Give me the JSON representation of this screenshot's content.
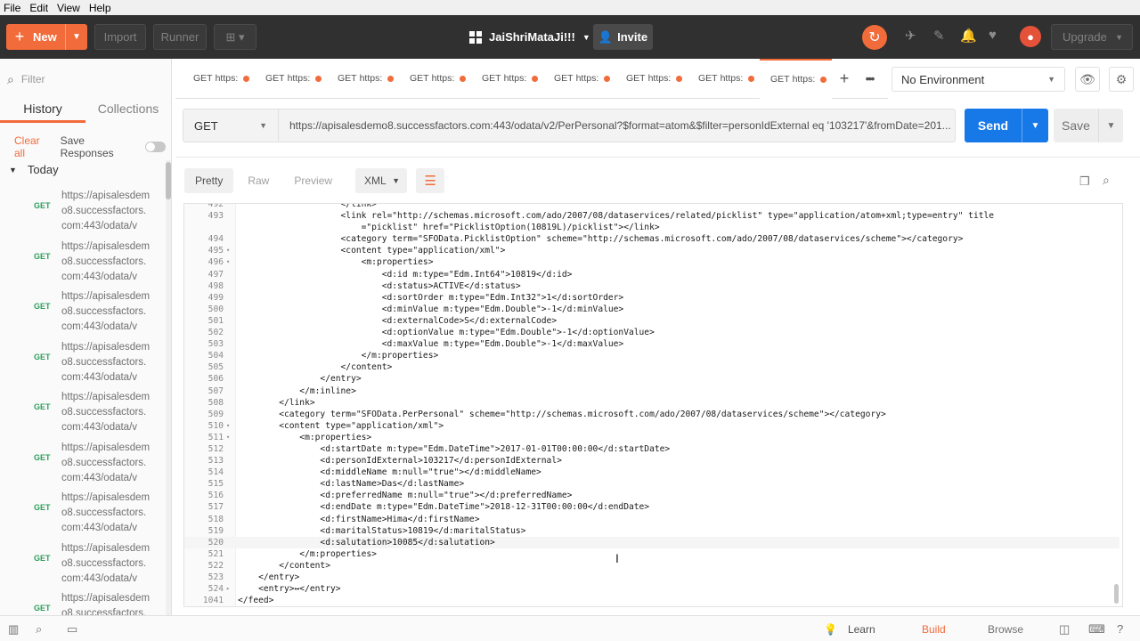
{
  "menu": [
    "File",
    "Edit",
    "View",
    "Help"
  ],
  "topbar": {
    "new_label": "New",
    "import_label": "Import",
    "runner_label": "Runner",
    "workspace": "JaiShriMataJi!!!",
    "invite_label": "Invite",
    "upgrade_label": "Upgrade",
    "accent": "#f26b3a"
  },
  "sidebar": {
    "filter_placeholder": "Filter",
    "tabs": [
      "History",
      "Collections"
    ],
    "clear_all": "Clear all",
    "save_responses": "Save Responses",
    "group": "Today",
    "items": [
      {
        "method": "GET",
        "url": "https://apisalesdemo8.successfactors.com:443/odata/v"
      },
      {
        "method": "GET",
        "url": "https://apisalesdemo8.successfactors.com:443/odata/v"
      },
      {
        "method": "GET",
        "url": "https://apisalesdemo8.successfactors.com:443/odata/v"
      },
      {
        "method": "GET",
        "url": "https://apisalesdemo8.successfactors.com:443/odata/v"
      },
      {
        "method": "GET",
        "url": "https://apisalesdemo8.successfactors.com:443/odata/v"
      },
      {
        "method": "GET",
        "url": "https://apisalesdemo8.successfactors.com:443/odata/v"
      },
      {
        "method": "GET",
        "url": "https://apisalesdemo8.successfactors.com:443/odata/v"
      },
      {
        "method": "GET",
        "url": "https://apisalesdemo8.successfactors.com:443/odata/v"
      },
      {
        "method": "GET",
        "url": "https://apisalesdemo8.successfactors.com:443/odata/v"
      }
    ]
  },
  "tabs": [
    {
      "method": "GET",
      "url": "https:"
    },
    {
      "method": "GET",
      "url": "https:"
    },
    {
      "method": "GET",
      "url": "https:"
    },
    {
      "method": "GET",
      "url": "https:"
    },
    {
      "method": "GET",
      "url": "https:"
    },
    {
      "method": "GET",
      "url": "https:"
    },
    {
      "method": "GET",
      "url": "https:"
    },
    {
      "method": "GET",
      "url": "https:"
    },
    {
      "method": "GET",
      "url": "https:"
    }
  ],
  "environment": "No Environment",
  "request": {
    "method": "GET",
    "url": "https://apisalesdemo8.successfactors.com:443/odata/v2/PerPersonal?$format=atom&$filter=personIdExternal eq '103217'&fromDate=201...",
    "send_label": "Send",
    "save_label": "Save"
  },
  "response": {
    "view_tabs": [
      "Pretty",
      "Raw",
      "Preview"
    ],
    "format": "XML",
    "lines": [
      {
        "n": "492",
        "f": "",
        "t": "                    </link>"
      },
      {
        "n": "493",
        "f": "",
        "t": "                    <link rel=\"http://schemas.microsoft.com/ado/2007/08/dataservices/related/picklist\" type=\"application/atom+xml;type=entry\" title"
      },
      {
        "n": "",
        "f": "",
        "t": "                        =\"picklist\" href=\"PicklistOption(10819L)/picklist\"></link>"
      },
      {
        "n": "494",
        "f": "",
        "t": "                    <category term=\"SFOData.PicklistOption\" scheme=\"http://schemas.microsoft.com/ado/2007/08/dataservices/scheme\"></category>"
      },
      {
        "n": "495",
        "f": "▾",
        "t": "                    <content type=\"application/xml\">"
      },
      {
        "n": "496",
        "f": "▾",
        "t": "                        <m:properties>"
      },
      {
        "n": "497",
        "f": "",
        "t": "                            <d:id m:type=\"Edm.Int64\">10819</d:id>"
      },
      {
        "n": "498",
        "f": "",
        "t": "                            <d:status>ACTIVE</d:status>"
      },
      {
        "n": "499",
        "f": "",
        "t": "                            <d:sortOrder m:type=\"Edm.Int32\">1</d:sortOrder>"
      },
      {
        "n": "500",
        "f": "",
        "t": "                            <d:minValue m:type=\"Edm.Double\">-1</d:minValue>"
      },
      {
        "n": "501",
        "f": "",
        "t": "                            <d:externalCode>S</d:externalCode>"
      },
      {
        "n": "502",
        "f": "",
        "t": "                            <d:optionValue m:type=\"Edm.Double\">-1</d:optionValue>"
      },
      {
        "n": "503",
        "f": "",
        "t": "                            <d:maxValue m:type=\"Edm.Double\">-1</d:maxValue>"
      },
      {
        "n": "504",
        "f": "",
        "t": "                        </m:properties>"
      },
      {
        "n": "505",
        "f": "",
        "t": "                    </content>"
      },
      {
        "n": "506",
        "f": "",
        "t": "                </entry>"
      },
      {
        "n": "507",
        "f": "",
        "t": "            </m:inline>"
      },
      {
        "n": "508",
        "f": "",
        "t": "        </link>"
      },
      {
        "n": "509",
        "f": "",
        "t": "        <category term=\"SFOData.PerPersonal\" scheme=\"http://schemas.microsoft.com/ado/2007/08/dataservices/scheme\"></category>"
      },
      {
        "n": "510",
        "f": "▾",
        "t": "        <content type=\"application/xml\">"
      },
      {
        "n": "511",
        "f": "▾",
        "t": "            <m:properties>"
      },
      {
        "n": "512",
        "f": "",
        "t": "                <d:startDate m:type=\"Edm.DateTime\">2017-01-01T00:00:00</d:startDate>"
      },
      {
        "n": "513",
        "f": "",
        "t": "                <d:personIdExternal>103217</d:personIdExternal>"
      },
      {
        "n": "514",
        "f": "",
        "t": "                <d:middleName m:null=\"true\"></d:middleName>"
      },
      {
        "n": "515",
        "f": "",
        "t": "                <d:lastName>Das</d:lastName>"
      },
      {
        "n": "516",
        "f": "",
        "t": "                <d:preferredName m:null=\"true\"></d:preferredName>"
      },
      {
        "n": "517",
        "f": "",
        "t": "                <d:endDate m:type=\"Edm.DateTime\">2018-12-31T00:00:00</d:endDate>"
      },
      {
        "n": "518",
        "f": "",
        "t": "                <d:firstName>Hima</d:firstName>"
      },
      {
        "n": "519",
        "f": "",
        "t": "                <d:maritalStatus>10819</d:maritalStatus>"
      },
      {
        "n": "520",
        "f": "",
        "t": "                <d:salutation>10085</d:salutation>"
      },
      {
        "n": "521",
        "f": "",
        "t": "            </m:properties>"
      },
      {
        "n": "522",
        "f": "",
        "t": "        </content>"
      },
      {
        "n": "523",
        "f": "",
        "t": "    </entry>"
      },
      {
        "n": "524",
        "f": "▸",
        "t": "    <entry>↔</entry>"
      },
      {
        "n": "1041",
        "f": "",
        "t": "</feed>"
      }
    ],
    "highlight_line": "520"
  },
  "statusbar": {
    "learn": "Learn",
    "build": "Build",
    "browse": "Browse"
  }
}
